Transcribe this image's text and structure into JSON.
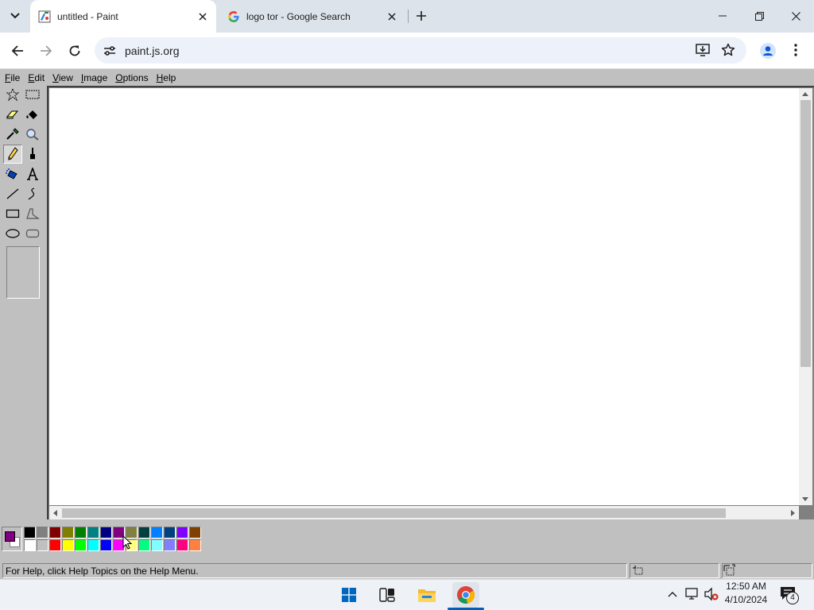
{
  "browser": {
    "tabs": [
      {
        "title": "untitled - Paint",
        "active": true,
        "favicon": "paint-icon"
      },
      {
        "title": "logo tor - Google Search",
        "active": false,
        "favicon": "google-icon"
      }
    ],
    "url": "paint.js.org"
  },
  "paint": {
    "menus": [
      {
        "u": "F",
        "rest": "ile"
      },
      {
        "u": "E",
        "rest": "dit"
      },
      {
        "u": "V",
        "rest": "iew"
      },
      {
        "u": "I",
        "rest": "mage"
      },
      {
        "u": "O",
        "rest": "ptions"
      },
      {
        "u": "H",
        "rest": "elp"
      }
    ],
    "tools": [
      "free-form-select",
      "rectangle-select",
      "eraser",
      "fill-with-color",
      "pick-color",
      "magnifier",
      "pencil",
      "brush",
      "airbrush",
      "text",
      "line",
      "curve",
      "rectangle",
      "polygon",
      "ellipse",
      "rounded-rectangle"
    ],
    "selected_tool": "pencil",
    "primary_color": "#800080",
    "secondary_color": "#ffffff",
    "palette_top": [
      "#000000",
      "#808080",
      "#800000",
      "#808000",
      "#008000",
      "#008080",
      "#000080",
      "#800080",
      "#808040",
      "#004040",
      "#0080ff",
      "#004080",
      "#8000ff",
      "#804000"
    ],
    "palette_bottom": [
      "#ffffff",
      "#c0c0c0",
      "#ff0000",
      "#ffff00",
      "#00ff00",
      "#00ffff",
      "#0000ff",
      "#ff00ff",
      "#ffff80",
      "#00ff80",
      "#80ffff",
      "#8080ff",
      "#ff0080",
      "#ff8040"
    ],
    "status_text": "For Help, click Help Topics on the Help Menu."
  },
  "taskbar": {
    "time": "12:50 AM",
    "date": "4/10/2024",
    "notification_count": "4"
  }
}
